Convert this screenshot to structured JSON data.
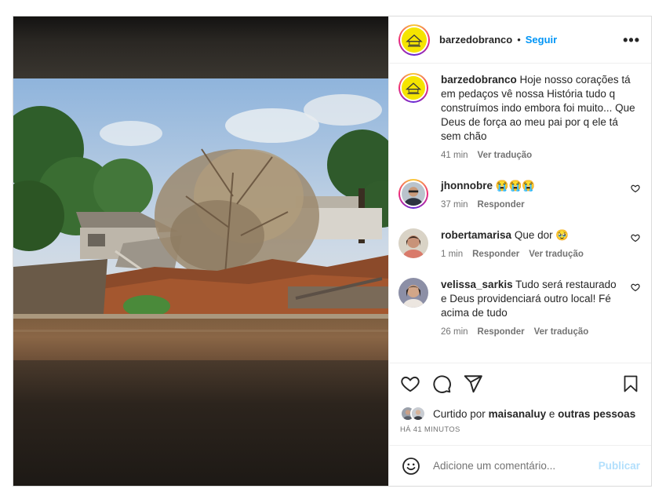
{
  "post": {
    "author": "barzedobranco",
    "separator": "•",
    "follow_label": "Seguir",
    "more_label": "•••",
    "caption": {
      "username": "barzedobranco",
      "text": "Hoje nosso corações tá em pedaços vê nossa História tudo q construímos indo embora foi muito... Que Deus de força ao meu pai por q ele tá sem chão",
      "time": "41 min",
      "translate": "Ver tradução"
    },
    "comments": [
      {
        "username": "jhonnobre",
        "text": "😭😭😭",
        "time": "37 min",
        "reply": "Responder",
        "translate": ""
      },
      {
        "username": "robertamarisa",
        "text": "Que dor 🥹",
        "time": "1 min",
        "reply": "Responder",
        "translate": "Ver tradução"
      },
      {
        "username": "velissa_sarkis",
        "text": "Tudo será restaurado e Deus providenciará outro local! Fé acima de tudo",
        "time": "26 min",
        "reply": "Responder",
        "translate": "Ver tradução"
      }
    ],
    "likes": {
      "prefix": "Curtido por",
      "user": "maisanaluy",
      "conj": "e",
      "others": "outras pessoas"
    },
    "posted_ago": "HÁ 41 MINUTOS",
    "add_comment": {
      "emoji_icon": "smile-icon",
      "placeholder": "Adicione um comentário...",
      "publish": "Publicar"
    }
  },
  "colors": {
    "follow": "#0095f6",
    "publish_disabled": "#b2dffc",
    "logo_yellow": "#f5e400"
  }
}
